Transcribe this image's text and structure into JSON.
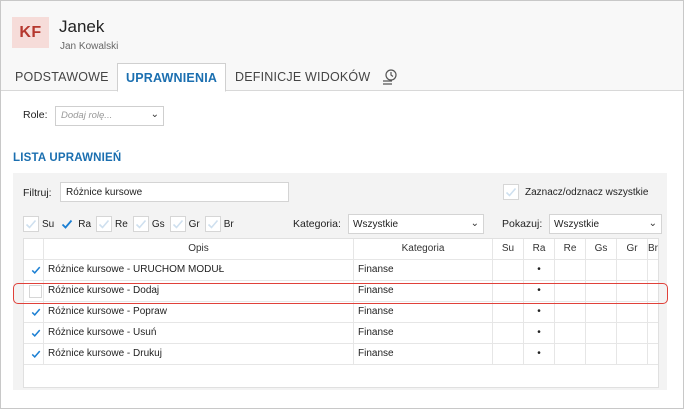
{
  "header": {
    "avatar_initials": "KF",
    "title": "Janek",
    "subtitle": "Jan Kowalski"
  },
  "tabs": [
    {
      "label": "PODSTAWOWE",
      "active": false
    },
    {
      "label": "UPRAWNIENIA",
      "active": true
    },
    {
      "label": "DEFINICJE WIDOKÓW",
      "active": false
    }
  ],
  "tab_history_icon": "history-icon",
  "roles": {
    "label": "Role:",
    "placeholder": "Dodaj rolę..."
  },
  "section_title": "LISTA UPRAWNIEŃ",
  "filter": {
    "label": "Filtruj:",
    "value": "Różnice kursowe"
  },
  "select_all_label": "Zaznacz/odznacz wszystkie",
  "perm_filters": [
    {
      "label": "Su",
      "checked": false
    },
    {
      "label": "Ra",
      "checked": true
    },
    {
      "label": "Re",
      "checked": false
    },
    {
      "label": "Gs",
      "checked": false
    },
    {
      "label": "Gr",
      "checked": false
    },
    {
      "label": "Br",
      "checked": false
    }
  ],
  "kategoria": {
    "label": "Kategoria:",
    "value": "Wszystkie"
  },
  "pokazuj": {
    "label": "Pokazuj:",
    "value": "Wszystkie"
  },
  "grid": {
    "columns": [
      "Opis",
      "Kategoria",
      "Su",
      "Ra",
      "Re",
      "Gs",
      "Gr",
      "Br"
    ],
    "rows": [
      {
        "checked": true,
        "opis": "Różnice kursowe - URUCHOM MODUŁ",
        "kategoria": "Finanse",
        "su": "",
        "ra": "•",
        "re": "",
        "gs": "",
        "gr": "",
        "br": ""
      },
      {
        "checked": false,
        "opis": "Różnice kursowe - Dodaj",
        "kategoria": "Finanse",
        "su": "",
        "ra": "•",
        "re": "",
        "gs": "",
        "gr": "",
        "br": ""
      },
      {
        "checked": true,
        "opis": "Różnice kursowe - Popraw",
        "kategoria": "Finanse",
        "su": "",
        "ra": "•",
        "re": "",
        "gs": "",
        "gr": "",
        "br": ""
      },
      {
        "checked": true,
        "opis": "Różnice kursowe - Usuń",
        "kategoria": "Finanse",
        "su": "",
        "ra": "•",
        "re": "",
        "gs": "",
        "gr": "",
        "br": ""
      },
      {
        "checked": true,
        "opis": "Różnice kursowe - Drukuj",
        "kategoria": "Finanse",
        "su": "",
        "ra": "•",
        "re": "",
        "gs": "",
        "gr": "",
        "br": ""
      }
    ]
  },
  "colors": {
    "accent": "#1b6fb0",
    "check": "#1b7fd3",
    "avatar_bg": "#f6dcd9",
    "avatar_fg": "#b5372e",
    "highlight": "#e0413a"
  }
}
